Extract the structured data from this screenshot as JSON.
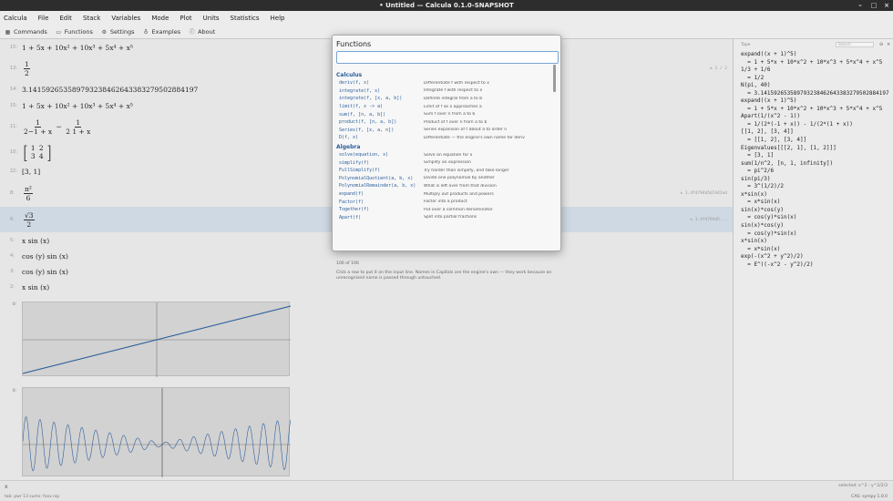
{
  "window": {
    "title": "• Untitled — Calcula 0.1.0-SNAPSHOT"
  },
  "menu": [
    "Calcula",
    "File",
    "Edit",
    "Stack",
    "Variables",
    "Mode",
    "Plot",
    "Units",
    "Statistics",
    "Help"
  ],
  "toolbar": [
    {
      "label": "Commands",
      "icon": "grid-icon"
    },
    {
      "label": "Functions",
      "icon": "book-icon"
    },
    {
      "label": "Settings",
      "icon": "gear-icon"
    },
    {
      "label": "Examples",
      "icon": "bulb-icon"
    },
    {
      "label": "About",
      "icon": "info-icon"
    }
  ],
  "worksheet": {
    "rows": [
      {
        "num": "15:",
        "text": "1 + 5x + 10x² + 10x³ + 5x⁴ + x⁵"
      },
      {
        "num": "13:",
        "frac": [
          "1",
          "2"
        ],
        "hash": "± 1 / 2"
      },
      {
        "num": "14:",
        "text": "3.1415926535897932384626433832795028841​97"
      },
      {
        "num": "15:",
        "text": "1 + 5x + 10x² + 10x³ + 5x⁴ + x⁵"
      },
      {
        "num": "11:",
        "pre": "",
        "frac": [
          "1",
          "2−1 + x"
        ],
        "mid": "−",
        "frac2": [
          "1",
          "2 1 + x"
        ]
      },
      {
        "num": "10:",
        "matrix": [
          "1",
          "2",
          "3",
          "4"
        ]
      },
      {
        "num": "22:",
        "text": "[3, 1]"
      },
      {
        "num": "8:",
        "frac": [
          "π²",
          "6"
        ]
      },
      {
        "num": "6:",
        "frac": [
          "√3",
          "2"
        ],
        "hash": "± 1.4f4794d5...",
        "selected": true
      },
      {
        "num": "5:",
        "text": "x sin (x)"
      },
      {
        "num": "4:",
        "text": "cos (y) sin (x)"
      },
      {
        "num": "3:",
        "text": "cos (y) sin (x)"
      },
      {
        "num": "2:",
        "text": "x sin (x)"
      }
    ],
    "hash_sel": "± 1.4f4794d5d7d42ed"
  },
  "side": {
    "header": "Tape",
    "filter_placeholder": "Search",
    "lines": [
      "expand((x + 1)^5)",
      "  = 1 + 5*x + 10*x^2 + 10*x^3 + 5*x^4 + x^5",
      "1/3 + 1/6",
      "  = 1/2",
      "N(pi, 40)",
      "  = 3.1415926535897932384626433832795028841​97",
      "expand((x + 1)^5)",
      "  = 1 + 5*x + 10*x^2 + 10*x^3 + 5*x^4 + x^5",
      "Apart(1/(x^2 - 1))",
      "  = 1/(2*(-1 + x)) - 1/(2*(1 + x))",
      "[[1, 2], [3, 4]]",
      "  = [[1, 2], [3, 4]]",
      "Eigenvalues[[[2, 1], [1, 2]]]",
      "  = [3, 1]",
      "sum(1/n^2, [n, 1, infinity])",
      "  = pi^2/6",
      "sin(pi/3)",
      "  = 3^(1/2)/2",
      "x*sin(x)",
      "  = x*sin(x)",
      "sin(x)*cos(y)",
      "  = cos(y)*sin(x)",
      "sin(x)*cos(y)",
      "  = cos(y)*sin(x)",
      "x*sin(x)",
      "  = x*sin(x)",
      "exp(-(x^2 + y^2)/2)",
      "  = E^((-x^2 - y^2)/2)"
    ]
  },
  "status": {
    "prompt": "x",
    "info": "tab: pwr 13   sums: fxxx  nip",
    "selection": "selected: x^2 - y^2/2/3",
    "mode": "CAS: sympy 1.0.0"
  },
  "modal": {
    "title": "Functions",
    "search_value": "",
    "sections": [
      {
        "name": "Calculus",
        "items": [
          {
            "sig": "deriv(f, x)",
            "desc": "Differentiate f with respect to x"
          },
          {
            "sig": "integrate(f, x)",
            "desc": "Integrate f with respect to x"
          },
          {
            "sig": "integrate(f, [x, a, b])",
            "desc": "Definite integral from a to b"
          },
          {
            "sig": "limit(f, x -> a)",
            "desc": "Limit of f as x approaches a"
          },
          {
            "sig": "sum(f, [n, a, b])",
            "desc": "Sum f over n from a to b"
          },
          {
            "sig": "product(f, [n, a, b])",
            "desc": "Product of f over n from a to b"
          },
          {
            "sig": "Series(f, [x, a, n])",
            "desc": "Series expansion of f about a to order n"
          },
          {
            "sig": "D(f, x)",
            "desc": "Differentiate — the engine's own name for deriv"
          }
        ]
      },
      {
        "name": "Algebra",
        "items": [
          {
            "sig": "solve(equation, x)",
            "desc": "Solve an equation for x"
          },
          {
            "sig": "simplify(f)",
            "desc": "Simplify an expression"
          },
          {
            "sig": "FullSimplify(f)",
            "desc": "Try harder than simplify, and take longer"
          },
          {
            "sig": "PolynomialQuotient(a, b, x)",
            "desc": "Divide one polynomial by another"
          },
          {
            "sig": "PolynomialRemainder(a, b, x)",
            "desc": "What is left over from that division"
          },
          {
            "sig": "expand(f)",
            "desc": "Multiply out products and powers"
          },
          {
            "sig": "Factor(f)",
            "desc": "Factor into a product"
          },
          {
            "sig": "Together(f)",
            "desc": "Put over a common denominator"
          },
          {
            "sig": "Apart(f)",
            "desc": "Split into partial fractions"
          }
        ]
      }
    ],
    "count": "106 of 106",
    "hint": "Click a row to put it on the input line. Names in Capitals are the engine's own — they work because an unrecognised name is passed through untouched."
  }
}
